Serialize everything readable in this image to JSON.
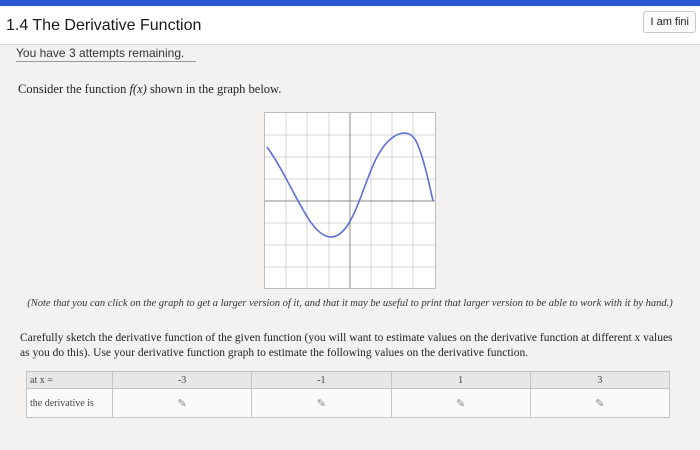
{
  "header": {
    "title": "1.4 The Derivative Function",
    "finish_label": "I am fini"
  },
  "attempts_text": "You have 3 attempts remaining.",
  "prompt": {
    "before": "Consider the function ",
    "func": "f(x)",
    "after": " shown in the graph below."
  },
  "note": "(Note that you can click on the graph to get a larger version of it, and that it may be useful to print that larger version to be able to work with it by hand.)",
  "instructions": "Carefully sketch the derivative function of the given function (you will want to estimate values on the derivative function at different x values as you do this). Use your derivative function graph to estimate the following values on the derivative function.",
  "table": {
    "header_label": "at x =",
    "x_values": [
      "-3",
      "-1",
      "1",
      "3"
    ],
    "row_label": "the derivative is",
    "answers": [
      "",
      "",
      "",
      ""
    ]
  },
  "colors": {
    "accent": "#2c56d4",
    "curve": "#5b6fd6"
  },
  "icons": {
    "answer_field": "pencil-icon"
  }
}
